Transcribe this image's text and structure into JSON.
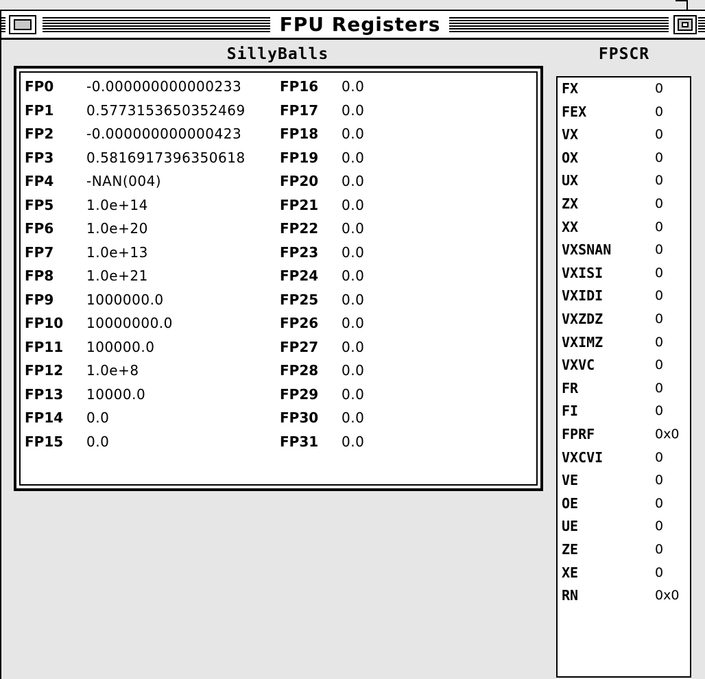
{
  "window": {
    "title": "FPU Registers"
  },
  "sections": {
    "registers_title": "SillyBalls",
    "fpscr_title": "FPSCR"
  },
  "registers": [
    {
      "name": "FP0",
      "value": "-0.000000000000233"
    },
    {
      "name": "FP1",
      "value": "0.5773153650352469"
    },
    {
      "name": "FP2",
      "value": "-0.000000000000423"
    },
    {
      "name": "FP3",
      "value": "0.5816917396350618"
    },
    {
      "name": "FP4",
      "value": "-NAN(004)"
    },
    {
      "name": "FP5",
      "value": "1.0e+14"
    },
    {
      "name": "FP6",
      "value": "1.0e+20"
    },
    {
      "name": "FP7",
      "value": "1.0e+13"
    },
    {
      "name": "FP8",
      "value": "1.0e+21"
    },
    {
      "name": "FP9",
      "value": "1000000.0"
    },
    {
      "name": "FP10",
      "value": "10000000.0"
    },
    {
      "name": "FP11",
      "value": "100000.0"
    },
    {
      "name": "FP12",
      "value": "1.0e+8"
    },
    {
      "name": "FP13",
      "value": "10000.0"
    },
    {
      "name": "FP14",
      "value": "0.0"
    },
    {
      "name": "FP15",
      "value": "0.0"
    },
    {
      "name": "FP16",
      "value": "0.0"
    },
    {
      "name": "FP17",
      "value": "0.0"
    },
    {
      "name": "FP18",
      "value": "0.0"
    },
    {
      "name": "FP19",
      "value": "0.0"
    },
    {
      "name": "FP20",
      "value": "0.0"
    },
    {
      "name": "FP21",
      "value": "0.0"
    },
    {
      "name": "FP22",
      "value": "0.0"
    },
    {
      "name": "FP23",
      "value": "0.0"
    },
    {
      "name": "FP24",
      "value": "0.0"
    },
    {
      "name": "FP25",
      "value": "0.0"
    },
    {
      "name": "FP26",
      "value": "0.0"
    },
    {
      "name": "FP27",
      "value": "0.0"
    },
    {
      "name": "FP28",
      "value": "0.0"
    },
    {
      "name": "FP29",
      "value": "0.0"
    },
    {
      "name": "FP30",
      "value": "0.0"
    },
    {
      "name": "FP31",
      "value": "0.0"
    }
  ],
  "fpscr": [
    {
      "name": "FX",
      "value": "0"
    },
    {
      "name": "FEX",
      "value": "0"
    },
    {
      "name": "VX",
      "value": "0"
    },
    {
      "name": "OX",
      "value": "0"
    },
    {
      "name": "UX",
      "value": "0"
    },
    {
      "name": "ZX",
      "value": "0"
    },
    {
      "name": "XX",
      "value": "0"
    },
    {
      "name": "VXSNAN",
      "value": "0"
    },
    {
      "name": "VXISI",
      "value": "0"
    },
    {
      "name": "VXIDI",
      "value": "0"
    },
    {
      "name": "VXZDZ",
      "value": "0"
    },
    {
      "name": "VXIMZ",
      "value": "0"
    },
    {
      "name": "VXVC",
      "value": "0"
    },
    {
      "name": "FR",
      "value": "0"
    },
    {
      "name": "FI",
      "value": "0"
    },
    {
      "name": "FPRF",
      "value": "0x0"
    },
    {
      "name": "VXCVI",
      "value": "0"
    },
    {
      "name": "VE",
      "value": "0"
    },
    {
      "name": "OE",
      "value": "0"
    },
    {
      "name": "UE",
      "value": "0"
    },
    {
      "name": "ZE",
      "value": "0"
    },
    {
      "name": "XE",
      "value": "0"
    },
    {
      "name": "RN",
      "value": "0x0"
    }
  ],
  "icons": {
    "close": "close-box-icon",
    "zoom": "zoom-box-icon"
  }
}
